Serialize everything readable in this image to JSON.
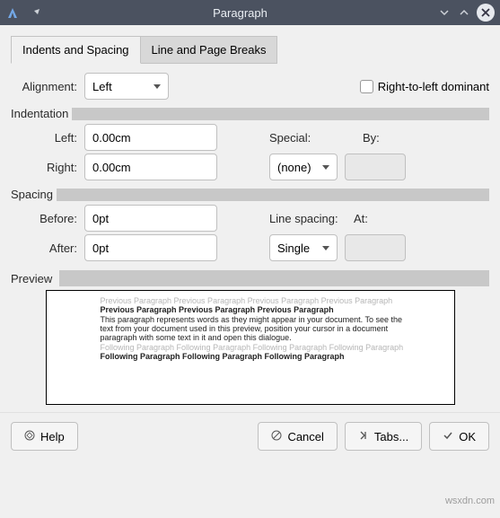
{
  "title": "Paragraph",
  "tabs": {
    "indentsSpacing": "Indents and Spacing",
    "linePageBreaks": "Line and Page Breaks"
  },
  "alignment": {
    "label": "Alignment:",
    "value": "Left",
    "rtl_label": "Right-to-left dominant"
  },
  "indentation": {
    "header": "Indentation",
    "left_label": "Left:",
    "left_value": "0.00cm",
    "right_label": "Right:",
    "right_value": "0.00cm",
    "special_label": "Special:",
    "special_value": "(none)",
    "by_label": "By:"
  },
  "spacing": {
    "header": "Spacing",
    "before_label": "Before:",
    "before_value": "0pt",
    "after_label": "After:",
    "after_value": "0pt",
    "line_label": "Line spacing:",
    "line_value": "Single",
    "at_label": "At:"
  },
  "preview": {
    "label": "Preview",
    "gray1": "Previous Paragraph Previous Paragraph Previous Paragraph Previous Paragraph",
    "bold1": "Previous Paragraph Previous Paragraph Previous Paragraph",
    "body1": "This paragraph represents words as they might appear in your document.  To see the",
    "body2": "text from your document used in this preview, position your cursor in a document",
    "body3": "paragraph with some text in it and open this dialogue.",
    "gray2": "Following Paragraph Following Paragraph Following Paragraph Following Paragraph",
    "bold2": "Following Paragraph Following Paragraph Following Paragraph"
  },
  "buttons": {
    "help": "Help",
    "cancel": "Cancel",
    "tabs": "Tabs...",
    "ok": "OK"
  },
  "watermark": "wsxdn.com"
}
